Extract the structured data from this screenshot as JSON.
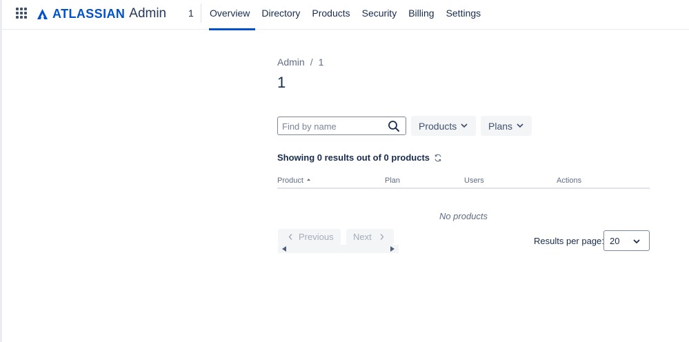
{
  "brand": {
    "wordmark": "ATLASSIAN",
    "product": "Admin",
    "accent_color": "#0052cc"
  },
  "org": {
    "name": "1"
  },
  "nav": {
    "tabs": [
      {
        "label": "Overview",
        "active": true
      },
      {
        "label": "Directory"
      },
      {
        "label": "Products"
      },
      {
        "label": "Security"
      },
      {
        "label": "Billing"
      },
      {
        "label": "Settings"
      }
    ]
  },
  "breadcrumb": {
    "root": "Admin",
    "separator": "/",
    "current": "1"
  },
  "page": {
    "title": "1"
  },
  "filters": {
    "search_placeholder": "Find by name",
    "search_value": "",
    "products_label": "Products",
    "plans_label": "Plans"
  },
  "results": {
    "summary": "Showing 0 results out of 0 products"
  },
  "table": {
    "columns": [
      "Product",
      "Plan",
      "Users",
      "Actions"
    ],
    "sorted_column": "Product",
    "empty_message": "No products"
  },
  "pagination": {
    "previous_label": "Previous",
    "next_label": "Next",
    "results_per_page_label": "Results per page:",
    "results_per_page_value": "20"
  }
}
